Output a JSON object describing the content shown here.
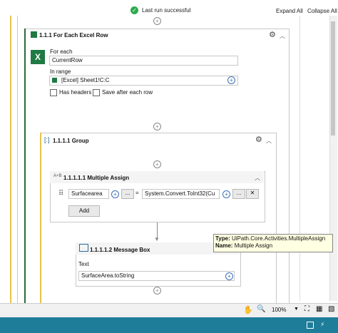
{
  "header": {
    "run_status": "Last run successful",
    "expand_all": "Expand All",
    "collapse_all": "Collapse All"
  },
  "for_each": {
    "title": "1.1.1  For Each Excel Row",
    "for_each_label": "For each",
    "for_each_value": "CurrentRow",
    "in_range_label": "In range",
    "in_range_value": "[Excel] Sheet1!C:C",
    "has_headers_label": "Has headers",
    "save_after_label": "Save after each row"
  },
  "group": {
    "title": "1.1.1.1  Group"
  },
  "multiple_assign": {
    "title": "1.1.1.1.1  Multiple Assign",
    "left_value": "Surfacearea",
    "ellipsis": "...",
    "equals": "=",
    "right_value": "System.Convert.ToInt32(Cu",
    "add_label": "Add"
  },
  "message_box": {
    "title": "1.1.1.1.2  Message Box",
    "text_label": "Text",
    "text_value": "SurfaceArea.toString"
  },
  "tooltip": {
    "type_label": "Type:",
    "type_value": "UiPath.Core.Activities.MultipleAssign",
    "name_label": "Name:",
    "name_value": "Multiple Assign"
  },
  "bottom_bar": {
    "zoom": "100%"
  },
  "colors": {
    "status_bar": "#1e7d98",
    "excel_green": "#1f7a43",
    "success_green": "#2eaa4e",
    "tooltip_bg": "#ffffe1"
  }
}
